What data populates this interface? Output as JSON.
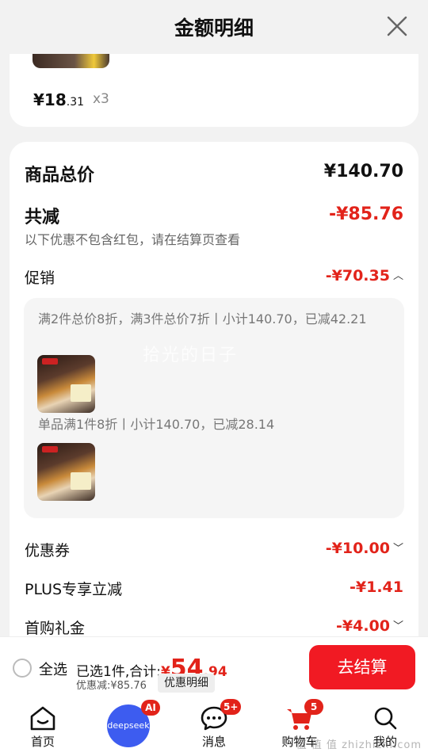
{
  "header": {
    "title": "金额明细"
  },
  "item": {
    "price_int": "¥18",
    "price_dec": ".31",
    "qty": "x3"
  },
  "summary": {
    "goods_total_label": "商品总价",
    "goods_total_value": "¥140.70",
    "reduce_label": "共减",
    "reduce_value": "-¥85.76",
    "note": "以下优惠不包含红包，请在结算页查看",
    "promo_label": "促销",
    "promo_value": "-¥70.35",
    "promo_lines": [
      "满2件总价8折，满3件总价7折丨小计140.70，已减42.21",
      "单品满1件8折丨小计140.70，已减28.14"
    ],
    "coupon_label": "优惠券",
    "coupon_value": "-¥10.00",
    "plus_label": "PLUS专享立减",
    "plus_value": "-¥1.41",
    "first_label": "首购礼金",
    "first_value": "-¥4.00"
  },
  "watermark": "拾光的日子",
  "bottom": {
    "select_all": "全选",
    "selected_prefix": "已选1件,合计:",
    "total_yen": "¥",
    "total_int": "54",
    "total_dec": ".94",
    "discount": "优惠减:¥85.76",
    "detail_btn": "优惠明细",
    "checkout_btn": "去结算"
  },
  "tabs": {
    "home": "首页",
    "ai_badge": "AI",
    "deepseek": "deepseek",
    "messages": "消息",
    "messages_badge": "5+",
    "cart": "购物车",
    "cart_badge": "5",
    "mine": "我的"
  },
  "corner_watermark": "值 值 值 zhizhizhi.com",
  "colors": {
    "accent_red": "#e2231a",
    "checkout_red": "#f11a23",
    "deepseek_blue": "#3d5cf0"
  }
}
